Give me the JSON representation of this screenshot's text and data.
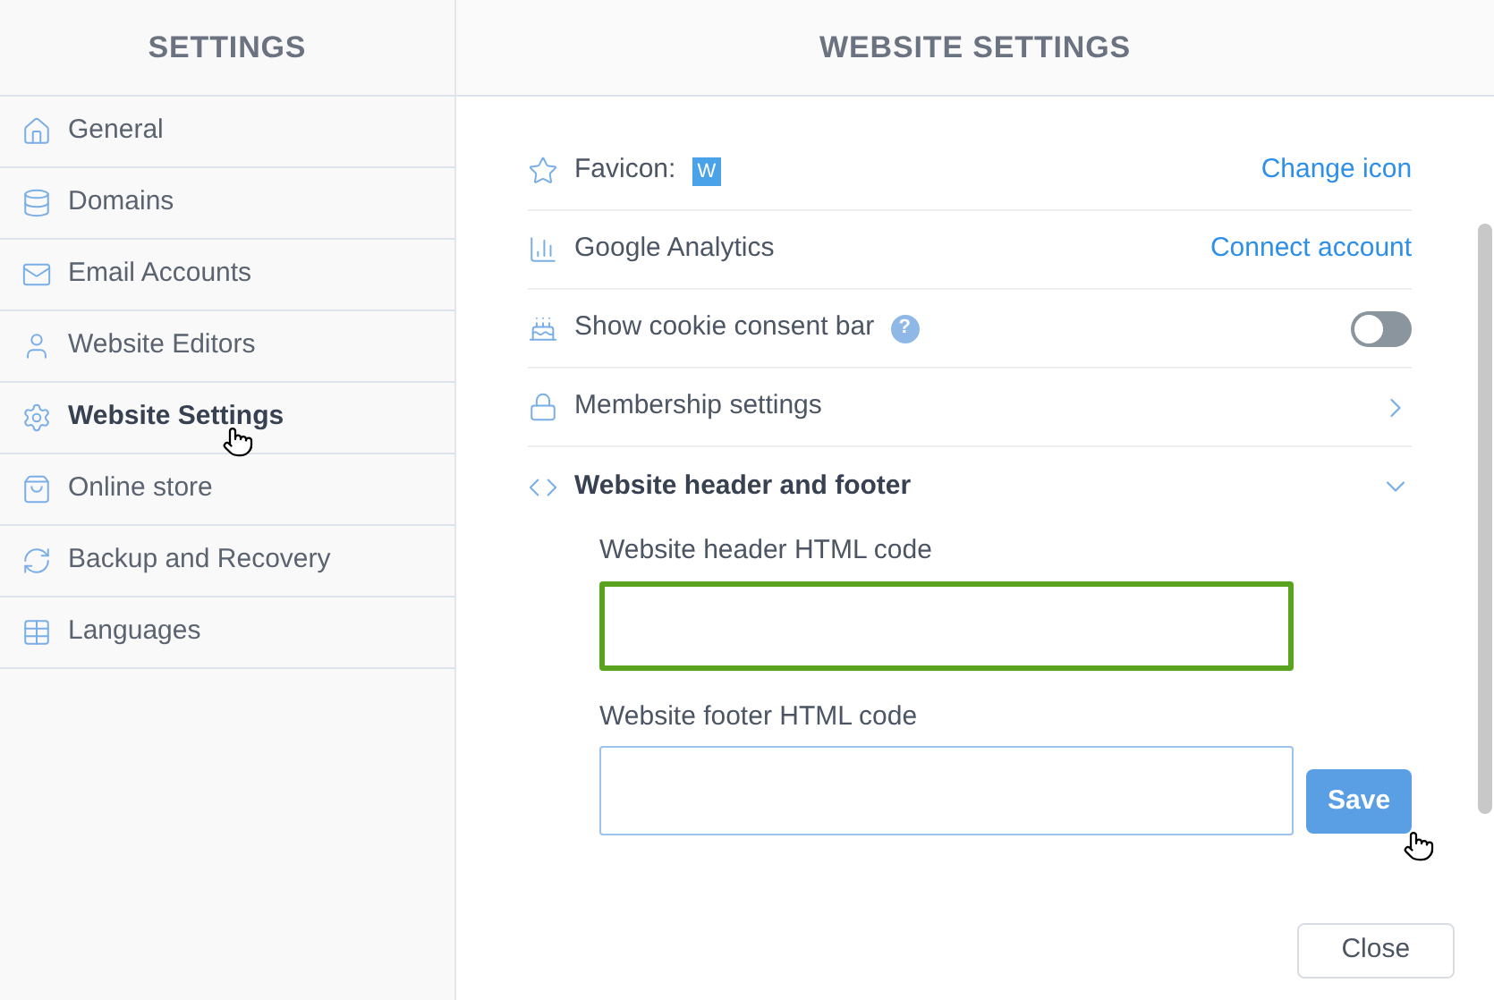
{
  "sidebar": {
    "title": "SETTINGS",
    "items": [
      {
        "label": "General",
        "selected": false
      },
      {
        "label": "Domains",
        "selected": false
      },
      {
        "label": "Email Accounts",
        "selected": false
      },
      {
        "label": "Website Editors",
        "selected": false
      },
      {
        "label": "Website Settings",
        "selected": true
      },
      {
        "label": "Online store",
        "selected": false
      },
      {
        "label": "Backup and Recovery",
        "selected": false
      },
      {
        "label": "Languages",
        "selected": false
      }
    ]
  },
  "main": {
    "title": "WEBSITE SETTINGS",
    "rows": [
      {
        "kind": "favicon",
        "label": "Favicon:",
        "badge": "W",
        "action": "Change icon"
      },
      {
        "kind": "link",
        "label": "Google Analytics",
        "action": "Connect account"
      },
      {
        "kind": "toggle",
        "label": "Show cookie consent bar",
        "help": "?",
        "on": false
      },
      {
        "kind": "chevron",
        "label": "Membership settings",
        "expanded": false
      },
      {
        "kind": "chevron",
        "label": "Website header and footer",
        "expanded": true
      }
    ],
    "fields": [
      {
        "label": "Website header HTML code",
        "focused": true
      },
      {
        "label": "Website footer HTML code",
        "focused": false
      }
    ],
    "save": "Save",
    "close": "Close"
  }
}
